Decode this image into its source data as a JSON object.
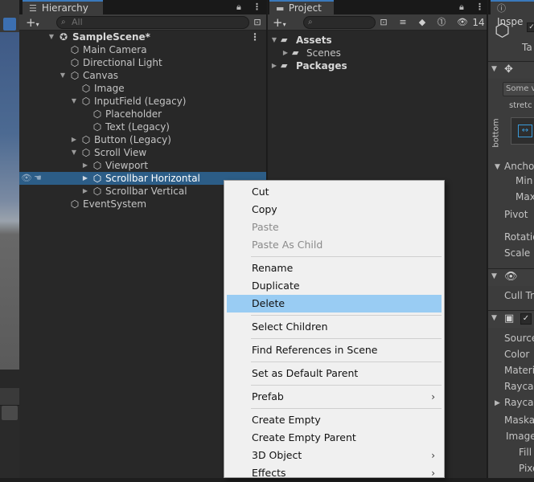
{
  "hierarchy": {
    "tab_label": "Hierarchy",
    "search_placeholder": "All",
    "rows": [
      {
        "label": "SampleScene*"
      },
      {
        "label": "Main Camera"
      },
      {
        "label": "Directional Light"
      },
      {
        "label": "Canvas"
      },
      {
        "label": "Image"
      },
      {
        "label": "InputField (Legacy)"
      },
      {
        "label": "Placeholder"
      },
      {
        "label": "Text (Legacy)"
      },
      {
        "label": "Button (Legacy)"
      },
      {
        "label": "Scroll View"
      },
      {
        "label": "Viewport"
      },
      {
        "label": "Scrollbar Horizontal"
      },
      {
        "label": "Scrollbar Vertical"
      },
      {
        "label": "EventSystem"
      }
    ]
  },
  "project": {
    "tab_label": "Project",
    "badge_count": "14",
    "rows": [
      {
        "label": "Assets"
      },
      {
        "label": "Scenes"
      },
      {
        "label": "Packages"
      }
    ]
  },
  "inspector": {
    "tab_label": "Inspe",
    "tag_label": "Ta",
    "some_value": "Some v",
    "stretch": "stretc",
    "bottom": "bottom",
    "anchors": "Ancho",
    "min": "Min",
    "max": "Max",
    "pivot": "Pivot",
    "rotation": "Rotatio",
    "scale": "Scale",
    "cull": "Cull Tr",
    "source": "Source",
    "color": "Color",
    "material": "Materi",
    "raycast_target": "Rayca",
    "raycast_padding": "Rayca",
    "maskable": "Maska",
    "image_type": "Image",
    "fill": "Fill",
    "pixels": "Pixe"
  },
  "context_menu": {
    "items": {
      "cut": "Cut",
      "copy": "Copy",
      "paste": "Paste",
      "paste_as_child": "Paste As Child",
      "rename": "Rename",
      "duplicate": "Duplicate",
      "delete": "Delete",
      "select_children": "Select Children",
      "find_references": "Find References in Scene",
      "set_default_parent": "Set as Default Parent",
      "prefab": "Prefab",
      "create_empty": "Create Empty",
      "create_empty_parent": "Create Empty Parent",
      "object_3d": "3D Object",
      "effects": "Effects"
    }
  },
  "colors": {
    "selection": "#2c5d87",
    "menu_highlight": "#99ccf3",
    "tab_accent": "#3a79bb"
  }
}
